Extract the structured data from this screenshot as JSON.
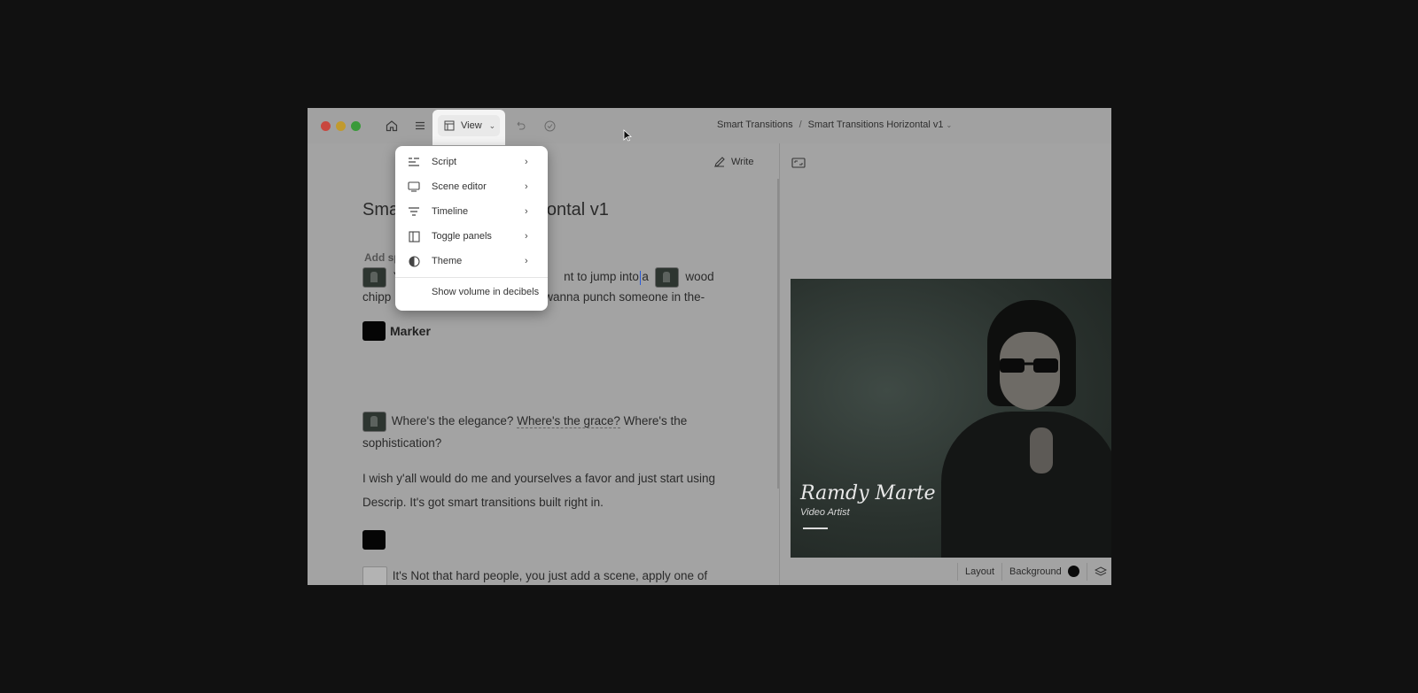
{
  "window": {
    "breadcrumb": {
      "project": "Smart Transitions",
      "separator": "/",
      "composition": "Smart Transitions Horizontal v1"
    },
    "view_label": "View"
  },
  "menu": {
    "items": [
      {
        "label": "Script",
        "icon": "script-icon"
      },
      {
        "label": "Scene editor",
        "icon": "scene-editor-icon"
      },
      {
        "label": "Timeline",
        "icon": "timeline-icon"
      },
      {
        "label": "Toggle panels",
        "icon": "toggle-panels-icon"
      },
      {
        "label": "Theme",
        "icon": "theme-icon"
      }
    ],
    "extra": "Show volume in decibels"
  },
  "script": {
    "write_label": "Write",
    "title_start": "Sma",
    "title_end": "ontal v1",
    "add_speaker": "Add sp",
    "line1": {
      "y_char": "Y",
      "text_a": "nt to jump into",
      "text_b": "a",
      "text_c": "wood"
    },
    "line2": {
      "text_a": "chipp",
      "text_b": "wanna punch someone in the-"
    },
    "marker_label": "Marker",
    "line3": {
      "a": "Where's the elegance?",
      "b": "Where's the grace?",
      "c": "Where's the"
    },
    "line4": "sophistication?",
    "line5": "I wish y'all would do me and yourselves a favor and just start using",
    "line6": "Descrip. It's got smart transitions built right in.",
    "line7": "It's Not that hard people, you just add a scene, apply one of"
  },
  "preview": {
    "name": "Ramdy Marte",
    "role": "Video Artist",
    "layout_label": "Layout",
    "background_label": "Background"
  }
}
